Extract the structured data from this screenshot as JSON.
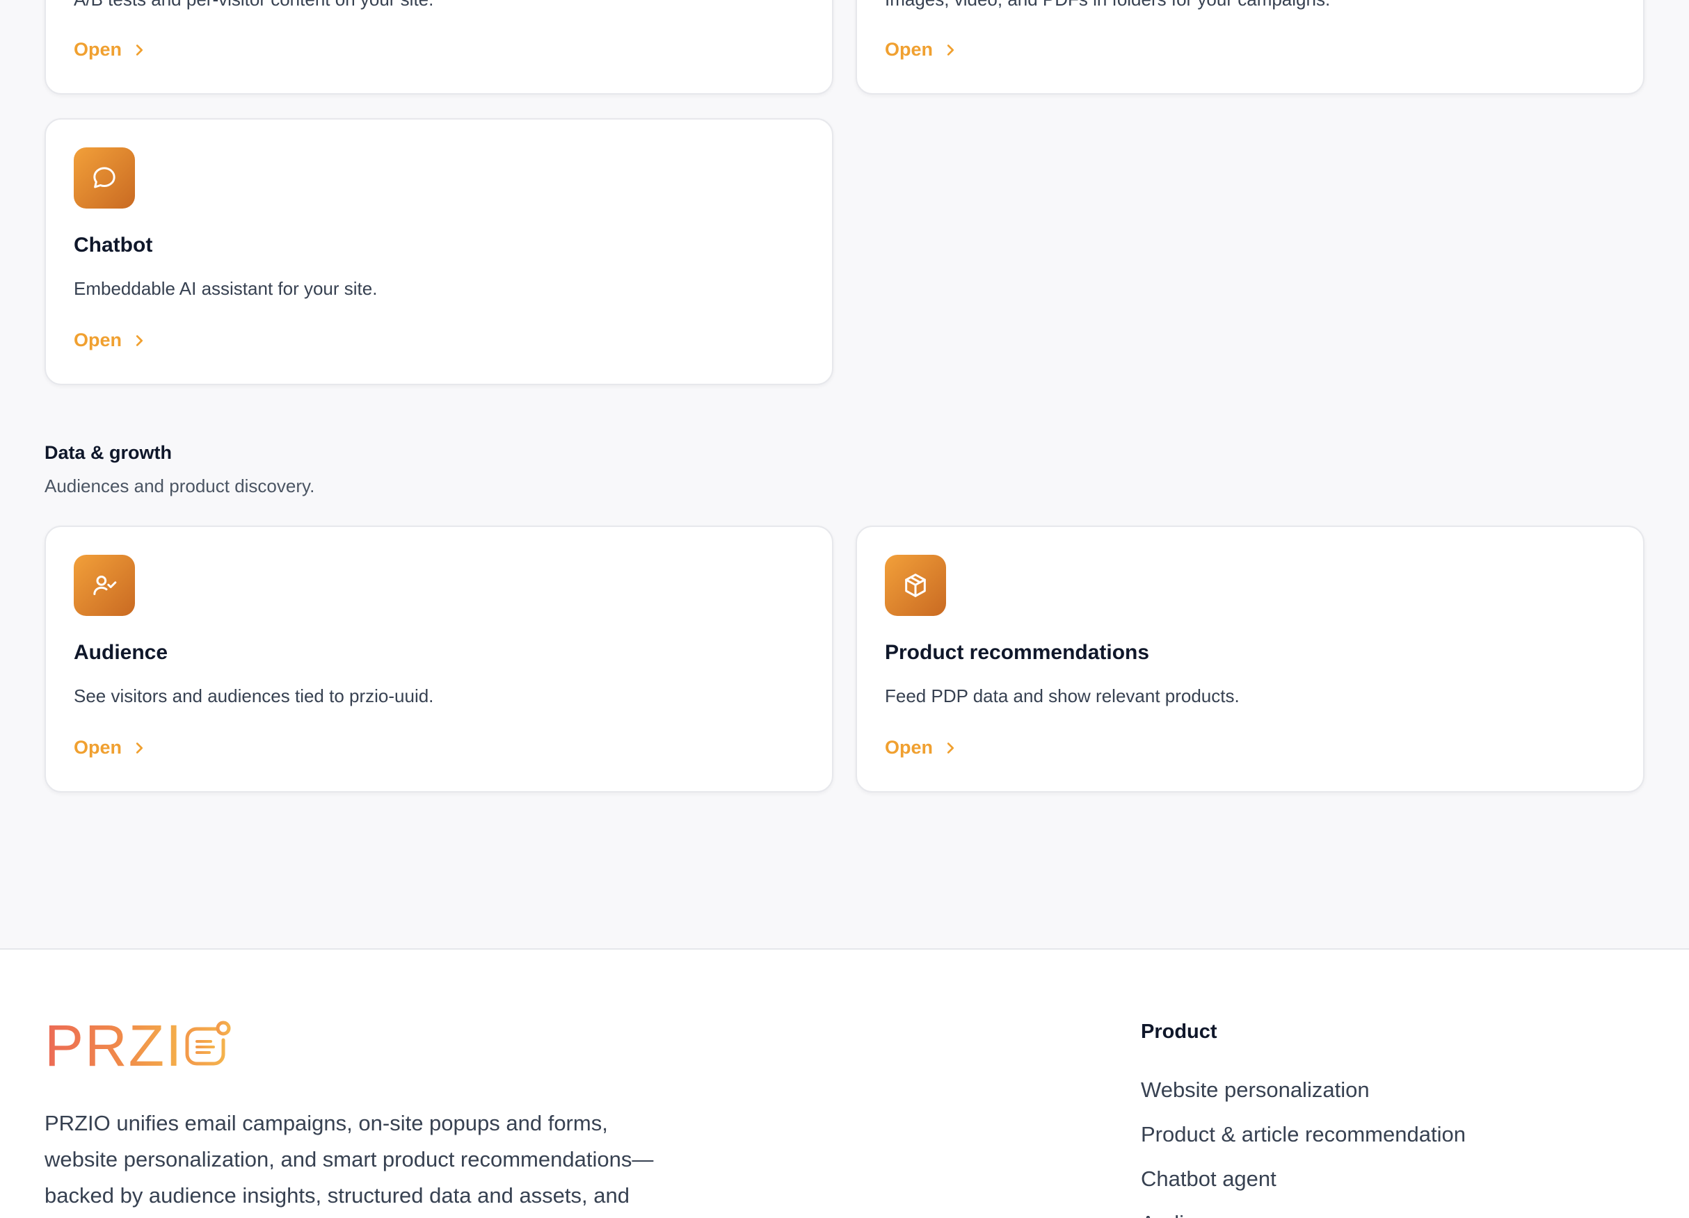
{
  "cards": {
    "ab_testing": {
      "description": "A/B tests and per-visitor content on your site.",
      "open_label": "Open"
    },
    "media_library": {
      "description": "Images, video, and PDFs in folders for your campaigns.",
      "open_label": "Open"
    },
    "chatbot": {
      "icon": "chat-bubble-icon",
      "title": "Chatbot",
      "description": "Embeddable AI assistant for your site.",
      "open_label": "Open"
    },
    "audience": {
      "icon": "user-check-icon",
      "title": "Audience",
      "description": "See visitors and audiences tied to przio-uuid.",
      "open_label": "Open"
    },
    "product_recommendations": {
      "icon": "package-icon",
      "title": "Product recommendations",
      "description": "Feed PDP data and show relevant products.",
      "open_label": "Open"
    }
  },
  "sections": {
    "data_growth": {
      "title": "Data & growth",
      "subtitle": "Audiences and product discovery."
    }
  },
  "footer": {
    "logo_text": "PRZI",
    "description": "PRZIO unifies email campaigns, on-site popups and forms, website personalization, and smart product recommendations—backed by audience insights, structured data and assets, and",
    "product_column": {
      "title": "Product",
      "links": [
        "Website personalization",
        "Product & article recommendation",
        "Chatbot agent",
        "Audience"
      ]
    }
  },
  "colors": {
    "accent": "#f0a030",
    "icon_gradient_start": "#f2a03a",
    "icon_gradient_end": "#c96a22",
    "page_background": "#f8f8fa"
  }
}
